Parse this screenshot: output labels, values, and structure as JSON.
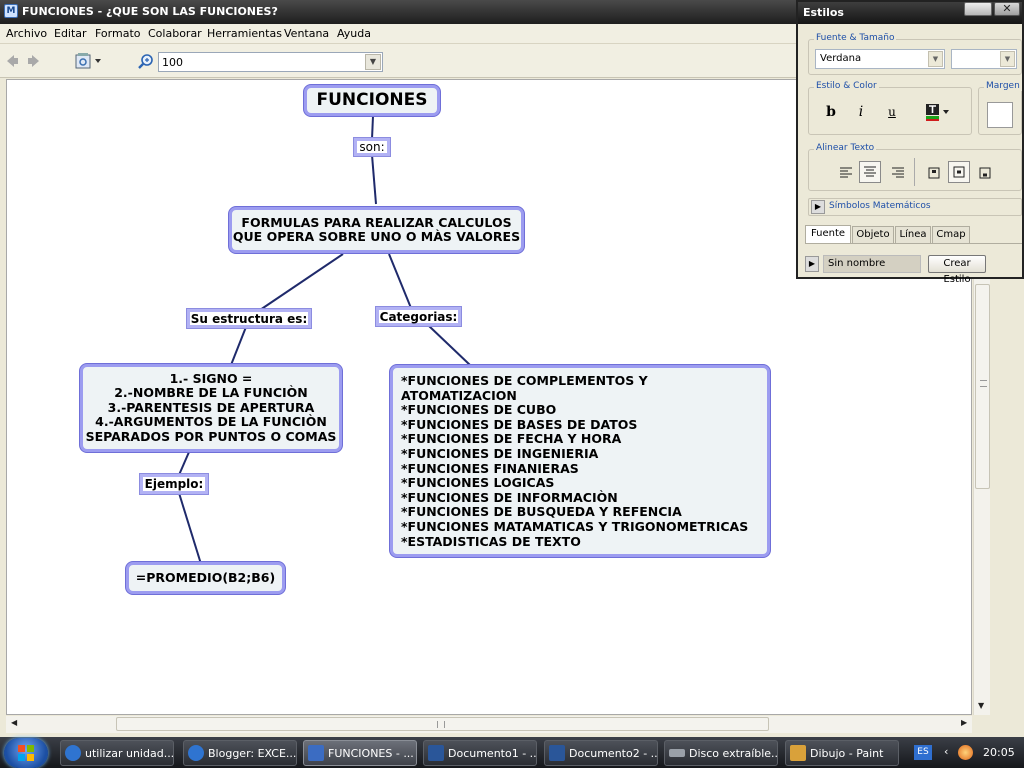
{
  "window": {
    "title": "FUNCIONES - ¿QUE SON LAS FUNCIONES?"
  },
  "menu": [
    "Archivo",
    "Editar",
    "Formato",
    "Colaborar",
    "Herramientas",
    "Ventana",
    "Ayuda"
  ],
  "toolbar": {
    "zoom_value": "100"
  },
  "concept_map": {
    "root": "FUNCIONES",
    "link_son": "son:",
    "definition": "FORMULAS PARA REALIZAR CALCULOS\nQUE OPERA SOBRE UNO O MÀS VALORES",
    "link_estructura": "Su estructura es:",
    "link_categorias": "Categorias:",
    "estructura": "1.- SIGNO =\n2.-NOMBRE DE LA FUNCIÒN\n3.-PARENTESIS DE APERTURA\n4.-ARGUMENTOS DE LA FUNCIÒN\nSEPARADOS POR PUNTOS O COMAS",
    "categorias": "*FUNCIONES DE COMPLEMENTOS Y ATOMATIZACION\n*FUNCIONES DE CUBO\n*FUNCIONES DE BASES DE DATOS\n*FUNCIONES DE FECHA Y HORA\n*FUNCIONES DE INGENIERIA\n*FUNCIONES FINANIERAS\n*FUNCIONES LOGICAS\n*FUNCIONES DE INFORMACIÒN\n*FUNCIONES DE BUSQUEDA Y REFENCIA\n*FUNCIONES MATAMATICAS Y TRIGONOMETRICAS\n*ESTADISTICAS DE TEXTO",
    "link_ejemplo": "Ejemplo:",
    "ejemplo": "=PROMEDIO(B2;B6)"
  },
  "styles_panel": {
    "title": "Estilos",
    "group_font": "Fuente & Tamaño",
    "font_name": "Verdana",
    "font_size": "",
    "group_style": "Estilo & Color",
    "bold_label": "b",
    "italic_label": "i",
    "underline_label": "u",
    "group_margin": "Margen",
    "group_align": "Alinear Texto",
    "math_symbols": "Símbolos Matemáticos",
    "tabs": [
      "Fuente",
      "Objeto",
      "Línea",
      "Cmap"
    ],
    "style_name": "Sin nombre",
    "create_style": "Crear Estilo"
  },
  "taskbar": {
    "items": [
      {
        "label": "utilizar unidad...",
        "color": "#2f74d0"
      },
      {
        "label": "Blogger: EXCE...",
        "color": "#2f74d0"
      },
      {
        "label": "FUNCIONES - ...",
        "color": "#3b6cc2"
      },
      {
        "label": "Documento1 - ...",
        "color": "#2a5699"
      },
      {
        "label": "Documento2 - ...",
        "color": "#2a5699"
      },
      {
        "label": "Disco extraíble...",
        "color": "#9aa0a8"
      },
      {
        "label": "Dibujo - Paint",
        "color": "#d9a13a"
      }
    ],
    "language": "ES",
    "clock": "20:05"
  },
  "colors": {
    "concept_border": "#9c9cf0",
    "concept_fill": "#eef3f5",
    "link_line": "#1f2a6b"
  }
}
